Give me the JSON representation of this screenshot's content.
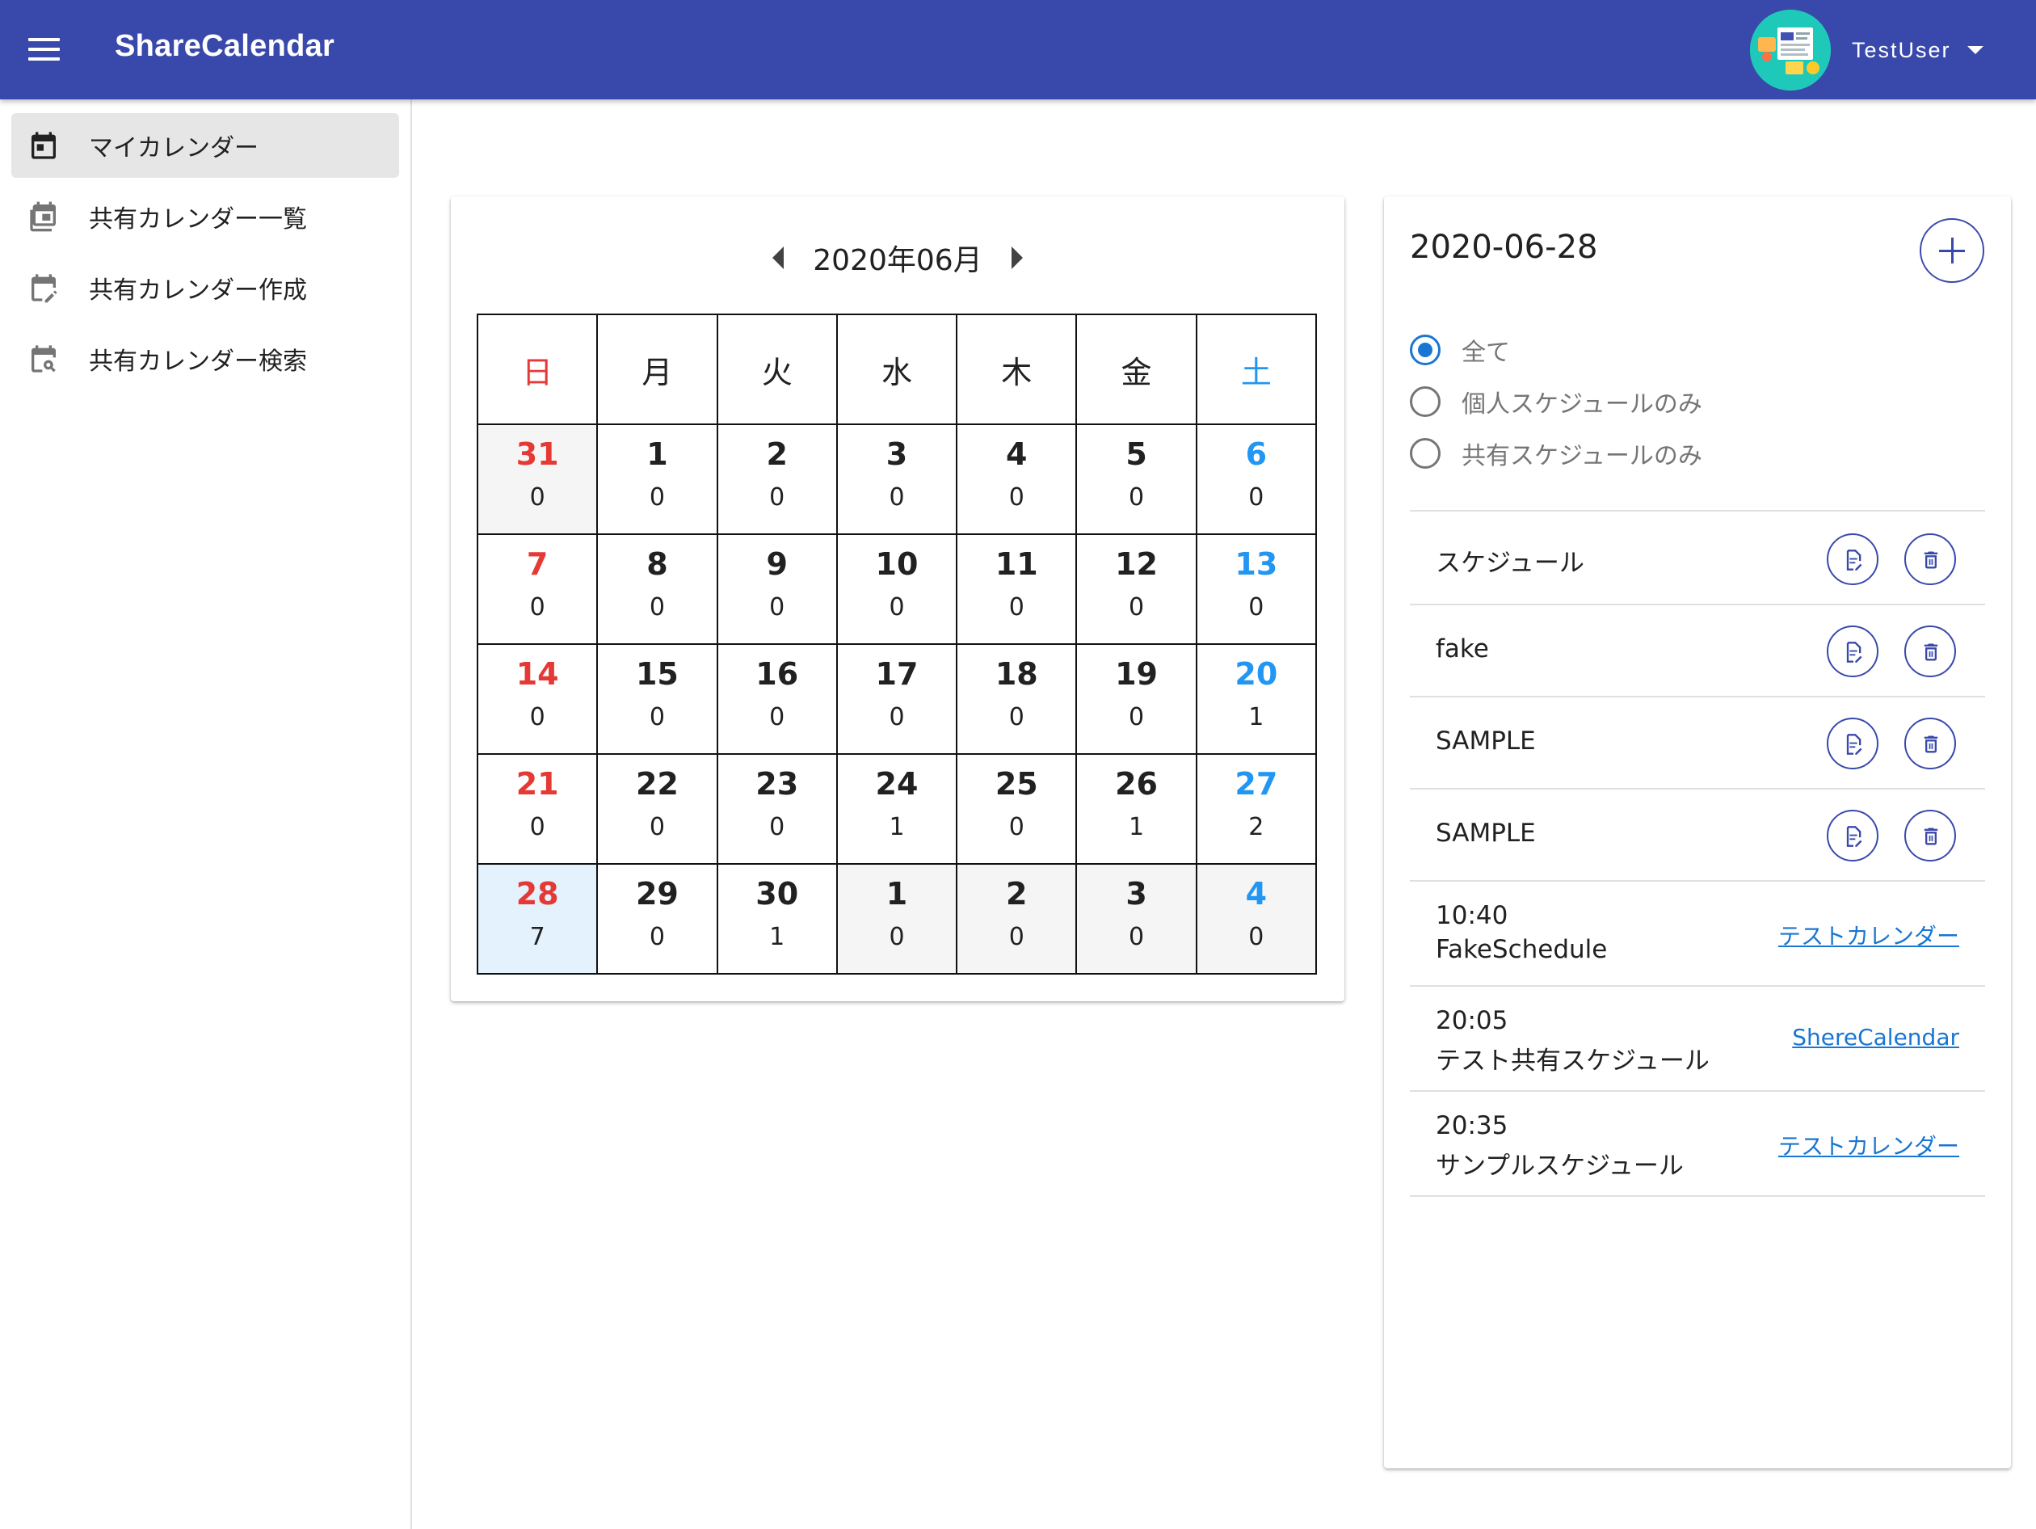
{
  "appbar": {
    "title": "ShareCalendar",
    "user_name": "TestUser",
    "color": "#3949ab"
  },
  "sidebar": {
    "items": [
      {
        "label": "マイカレンダー",
        "icon": "calendar-icon",
        "active": true
      },
      {
        "label": "共有カレンダー一覧",
        "icon": "calendar-list-icon",
        "active": false
      },
      {
        "label": "共有カレンダー作成",
        "icon": "calendar-edit-icon",
        "active": false
      },
      {
        "label": "共有カレンダー検索",
        "icon": "calendar-search-icon",
        "active": false
      }
    ]
  },
  "calendar": {
    "month_label": "2020年06月",
    "weekdays": [
      "日",
      "月",
      "火",
      "水",
      "木",
      "金",
      "土"
    ],
    "weeks": [
      [
        {
          "day": "31",
          "count": "0",
          "other": true
        },
        {
          "day": "1",
          "count": "0"
        },
        {
          "day": "2",
          "count": "0"
        },
        {
          "day": "3",
          "count": "0"
        },
        {
          "day": "4",
          "count": "0"
        },
        {
          "day": "5",
          "count": "0"
        },
        {
          "day": "6",
          "count": "0"
        }
      ],
      [
        {
          "day": "7",
          "count": "0"
        },
        {
          "day": "8",
          "count": "0"
        },
        {
          "day": "9",
          "count": "0"
        },
        {
          "day": "10",
          "count": "0"
        },
        {
          "day": "11",
          "count": "0"
        },
        {
          "day": "12",
          "count": "0"
        },
        {
          "day": "13",
          "count": "0"
        }
      ],
      [
        {
          "day": "14",
          "count": "0"
        },
        {
          "day": "15",
          "count": "0"
        },
        {
          "day": "16",
          "count": "0"
        },
        {
          "day": "17",
          "count": "0"
        },
        {
          "day": "18",
          "count": "0"
        },
        {
          "day": "19",
          "count": "0"
        },
        {
          "day": "20",
          "count": "1"
        }
      ],
      [
        {
          "day": "21",
          "count": "0"
        },
        {
          "day": "22",
          "count": "0"
        },
        {
          "day": "23",
          "count": "0"
        },
        {
          "day": "24",
          "count": "1"
        },
        {
          "day": "25",
          "count": "0"
        },
        {
          "day": "26",
          "count": "1"
        },
        {
          "day": "27",
          "count": "2"
        }
      ],
      [
        {
          "day": "28",
          "count": "7",
          "selected": true
        },
        {
          "day": "29",
          "count": "0"
        },
        {
          "day": "30",
          "count": "1"
        },
        {
          "day": "1",
          "count": "0",
          "other": true
        },
        {
          "day": "2",
          "count": "0",
          "other": true
        },
        {
          "day": "3",
          "count": "0",
          "other": true
        },
        {
          "day": "4",
          "count": "0",
          "other": true
        }
      ]
    ],
    "colors": {
      "sunday": "#e53935",
      "saturday": "#2196f3",
      "selected_bg": "#e3f2fd",
      "other_month_bg": "#f5f5f5"
    }
  },
  "schedule": {
    "date": "2020-06-28",
    "filters": [
      {
        "label": "全て",
        "checked": true
      },
      {
        "label": "個人スケジュールのみ",
        "checked": false
      },
      {
        "label": "共有スケジュールのみ",
        "checked": false
      }
    ],
    "personal": [
      {
        "title": "スケジュール"
      },
      {
        "title": "fake"
      },
      {
        "title": "SAMPLE"
      },
      {
        "title": "SAMPLE"
      }
    ],
    "shared": [
      {
        "time": "10:40",
        "name": "FakeSchedule",
        "calendar": "テストカレンダー"
      },
      {
        "time": "20:05",
        "name": "テスト共有スケジュール",
        "calendar": "ShereCalendar"
      },
      {
        "time": "20:35",
        "name": "サンプルスケジュール",
        "calendar": "テストカレンダー"
      }
    ],
    "accent_color": "#3949ab",
    "link_color": "#1976d2"
  }
}
